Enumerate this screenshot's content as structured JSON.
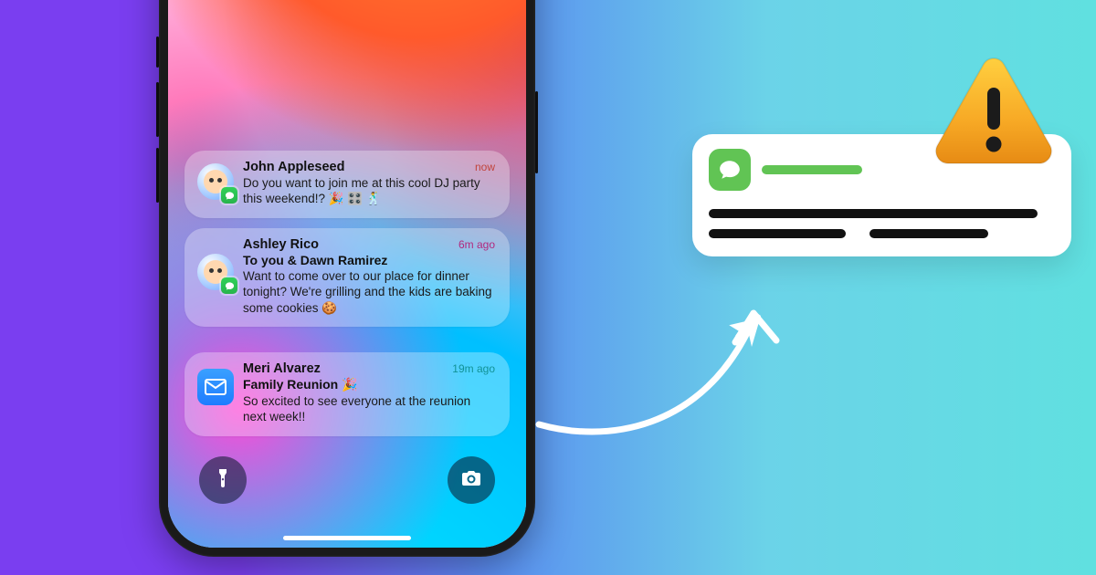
{
  "notifications": [
    {
      "sender": "John Appleseed",
      "timestamp": "now",
      "body": "Do you want to join me at this cool DJ party this weekend!? 🎉 🎛️ 🕺"
    },
    {
      "sender": "Ashley Rico",
      "timestamp": "6m ago",
      "recipients": "To you & Dawn Ramirez",
      "body": "Want to come over to our place for dinner tonight? We're grilling and the kids are baking some cookies 🍪"
    },
    {
      "sender": "Meri Alvarez",
      "timestamp": "19m ago",
      "subject": "Family Reunion 🎉",
      "body": "So excited to see everyone at the reunion next week!!"
    }
  ],
  "icons": {
    "messages_mini": "messages-badge-icon",
    "mail": "mail-icon",
    "flashlight": "flashlight-icon",
    "camera": "camera-icon",
    "warn": "warning-icon",
    "card_app": "messages-app-icon"
  }
}
